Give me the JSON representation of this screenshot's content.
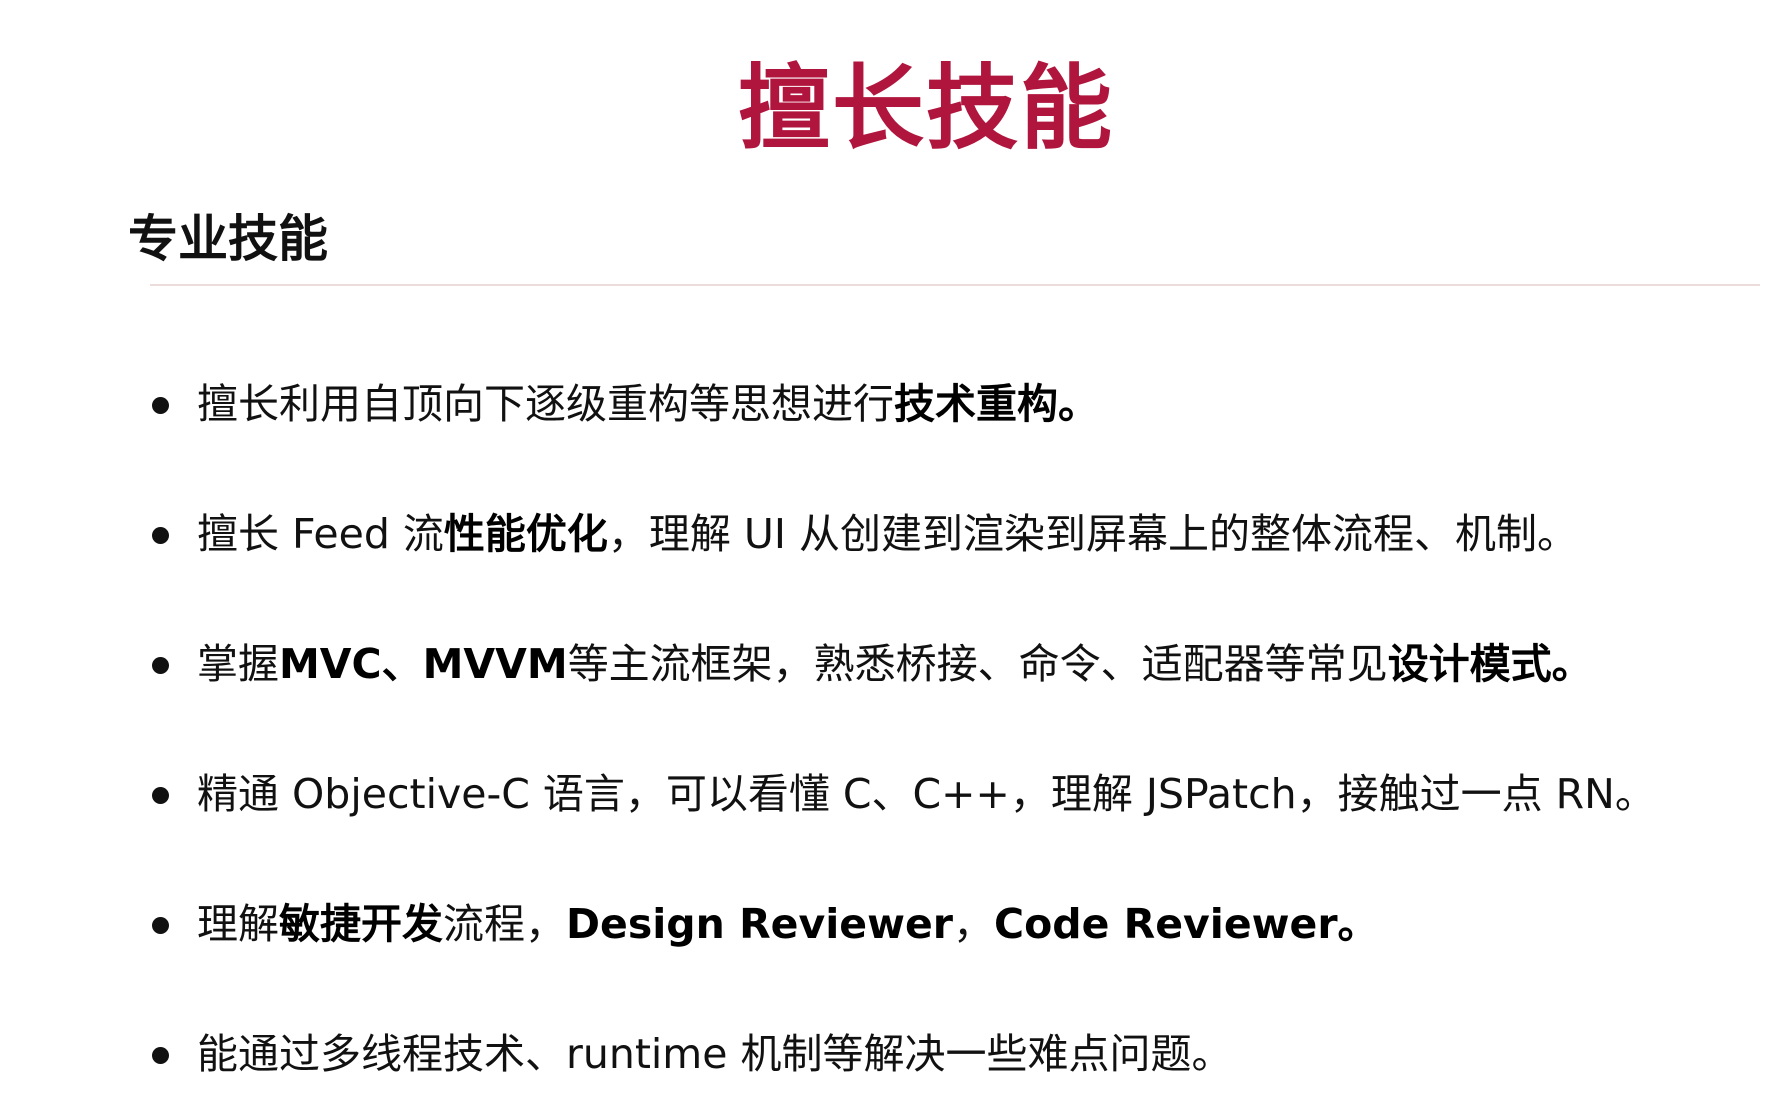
{
  "slide": {
    "title": "擅长技能",
    "section_heading": "专业技能",
    "bullets": [
      {
        "parts": [
          {
            "text": "擅长利用自顶向下逐级重构等思想进行",
            "bold": false
          },
          {
            "text": "技术重构。",
            "bold": true
          }
        ]
      },
      {
        "parts": [
          {
            "text": "擅长 Feed 流",
            "bold": false
          },
          {
            "text": "性能优化",
            "bold": true
          },
          {
            "text": "，理解 UI 从创建到渲染到屏幕上的整体流程、机制。",
            "bold": false
          }
        ]
      },
      {
        "parts": [
          {
            "text": "掌握 ",
            "bold": false
          },
          {
            "text": "MVC、MVVM",
            "bold": true
          },
          {
            "text": " 等主流框架，熟悉桥接、命令、适配器等常见",
            "bold": false
          },
          {
            "text": "设计模式。",
            "bold": true
          }
        ]
      },
      {
        "parts": [
          {
            "text": "精通 Objective-C 语言，可以看懂 C、C++，理解 JSPatch，接触过一点 RN。",
            "bold": false
          }
        ]
      },
      {
        "parts": [
          {
            "text": "理解",
            "bold": false
          },
          {
            "text": "敏捷开发",
            "bold": true
          },
          {
            "text": "流程，",
            "bold": false
          },
          {
            "text": "Design Reviewer",
            "bold": true
          },
          {
            "text": "，",
            "bold": false
          },
          {
            "text": "Code Reviewer。",
            "bold": true
          }
        ]
      },
      {
        "parts": [
          {
            "text": "能通过多线程技术、runtime 机制等解决一些难点问题。",
            "bold": false
          }
        ]
      }
    ]
  },
  "colors": {
    "title": "#b0163d",
    "text": "#111111",
    "divider": "#ecdcdc"
  }
}
